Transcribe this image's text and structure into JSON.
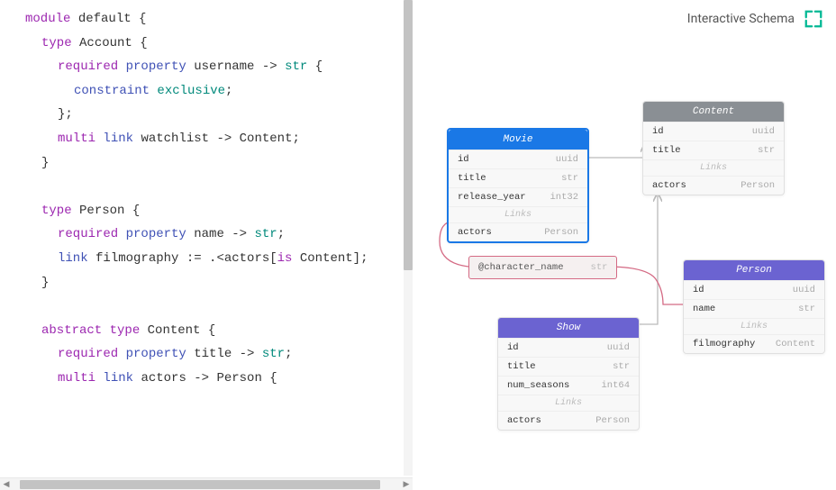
{
  "header": {
    "title": "Interactive Schema"
  },
  "code": {
    "t_module": "module",
    "t_default": "default {",
    "t_type": "type",
    "t_abstract": "abstract",
    "t_required": "required",
    "t_property": "property",
    "t_constraint": "constraint",
    "t_multi": "multi",
    "t_link": "link",
    "t_str": "str",
    "t_exclusive": "exclusive",
    "nm_account": "Account {",
    "nm_person": "Person {",
    "nm_content": "Content {",
    "p_username": "username -> ",
    "p_name": "name -> ",
    "p_title": "title -> ",
    "p_watchlist": "watchlist -> Content;",
    "p_filmography": "filmography := .<actors[",
    "p_is": "is",
    "p_rest": " Content];",
    "p_actors": "actors -> Person {",
    "open_brace": " {",
    "close_brace": "}",
    "semi": ";",
    "close_semi": "};"
  },
  "entities": {
    "movie": {
      "name": "Movie",
      "rows": [
        {
          "n": "id",
          "t": "uuid"
        },
        {
          "n": "title",
          "t": "str"
        },
        {
          "n": "release_year",
          "t": "int32"
        }
      ],
      "links_label": "Links",
      "links": [
        {
          "n": "actors",
          "t": "Person"
        }
      ]
    },
    "content": {
      "name": "Content",
      "rows": [
        {
          "n": "id",
          "t": "uuid"
        },
        {
          "n": "title",
          "t": "str"
        }
      ],
      "links_label": "Links",
      "links": [
        {
          "n": "actors",
          "t": "Person"
        }
      ]
    },
    "person": {
      "name": "Person",
      "rows": [
        {
          "n": "id",
          "t": "uuid"
        },
        {
          "n": "name",
          "t": "str"
        }
      ],
      "links_label": "Links",
      "links": [
        {
          "n": "filmography",
          "t": "Content"
        }
      ]
    },
    "show": {
      "name": "Show",
      "rows": [
        {
          "n": "id",
          "t": "uuid"
        },
        {
          "n": "title",
          "t": "str"
        },
        {
          "n": "num_seasons",
          "t": "int64"
        }
      ],
      "links_label": "Links",
      "links": [
        {
          "n": "actors",
          "t": "Person"
        }
      ]
    },
    "linkprop": {
      "name": "@character_name",
      "type": "str"
    }
  }
}
